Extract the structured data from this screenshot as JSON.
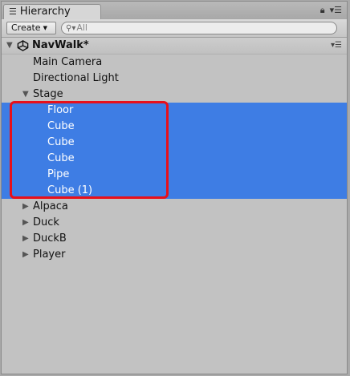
{
  "tab": {
    "title": "Hierarchy",
    "list_icon": "list-icon",
    "lock_icon": "lock-icon",
    "menu_icon": "panel-menu-icon"
  },
  "toolbar": {
    "create_label": "Create",
    "search_placeholder": "All"
  },
  "scene": {
    "name": "NavWalk*",
    "icon": "unity-scene-icon"
  },
  "items": [
    {
      "label": "Main Camera",
      "depth": 1,
      "foldout": "none",
      "selected": false
    },
    {
      "label": "Directional Light",
      "depth": 1,
      "foldout": "none",
      "selected": false
    },
    {
      "label": "Stage",
      "depth": 1,
      "foldout": "expanded",
      "selected": false
    },
    {
      "label": "Floor",
      "depth": 2,
      "foldout": "none",
      "selected": true
    },
    {
      "label": "Cube",
      "depth": 2,
      "foldout": "none",
      "selected": true
    },
    {
      "label": "Cube",
      "depth": 2,
      "foldout": "none",
      "selected": true
    },
    {
      "label": "Cube",
      "depth": 2,
      "foldout": "none",
      "selected": true
    },
    {
      "label": "Pipe",
      "depth": 2,
      "foldout": "none",
      "selected": true
    },
    {
      "label": "Cube (1)",
      "depth": 2,
      "foldout": "none",
      "selected": true
    },
    {
      "label": "Alpaca",
      "depth": 1,
      "foldout": "collapsed",
      "selected": false
    },
    {
      "label": "Duck",
      "depth": 1,
      "foldout": "collapsed",
      "selected": false
    },
    {
      "label": "DuckB",
      "depth": 1,
      "foldout": "collapsed",
      "selected": false
    },
    {
      "label": "Player",
      "depth": 1,
      "foldout": "collapsed",
      "selected": false
    }
  ],
  "colors": {
    "selection": "#3e7de4",
    "annotation": "#e8101a",
    "panel": "#c2c2c2"
  }
}
